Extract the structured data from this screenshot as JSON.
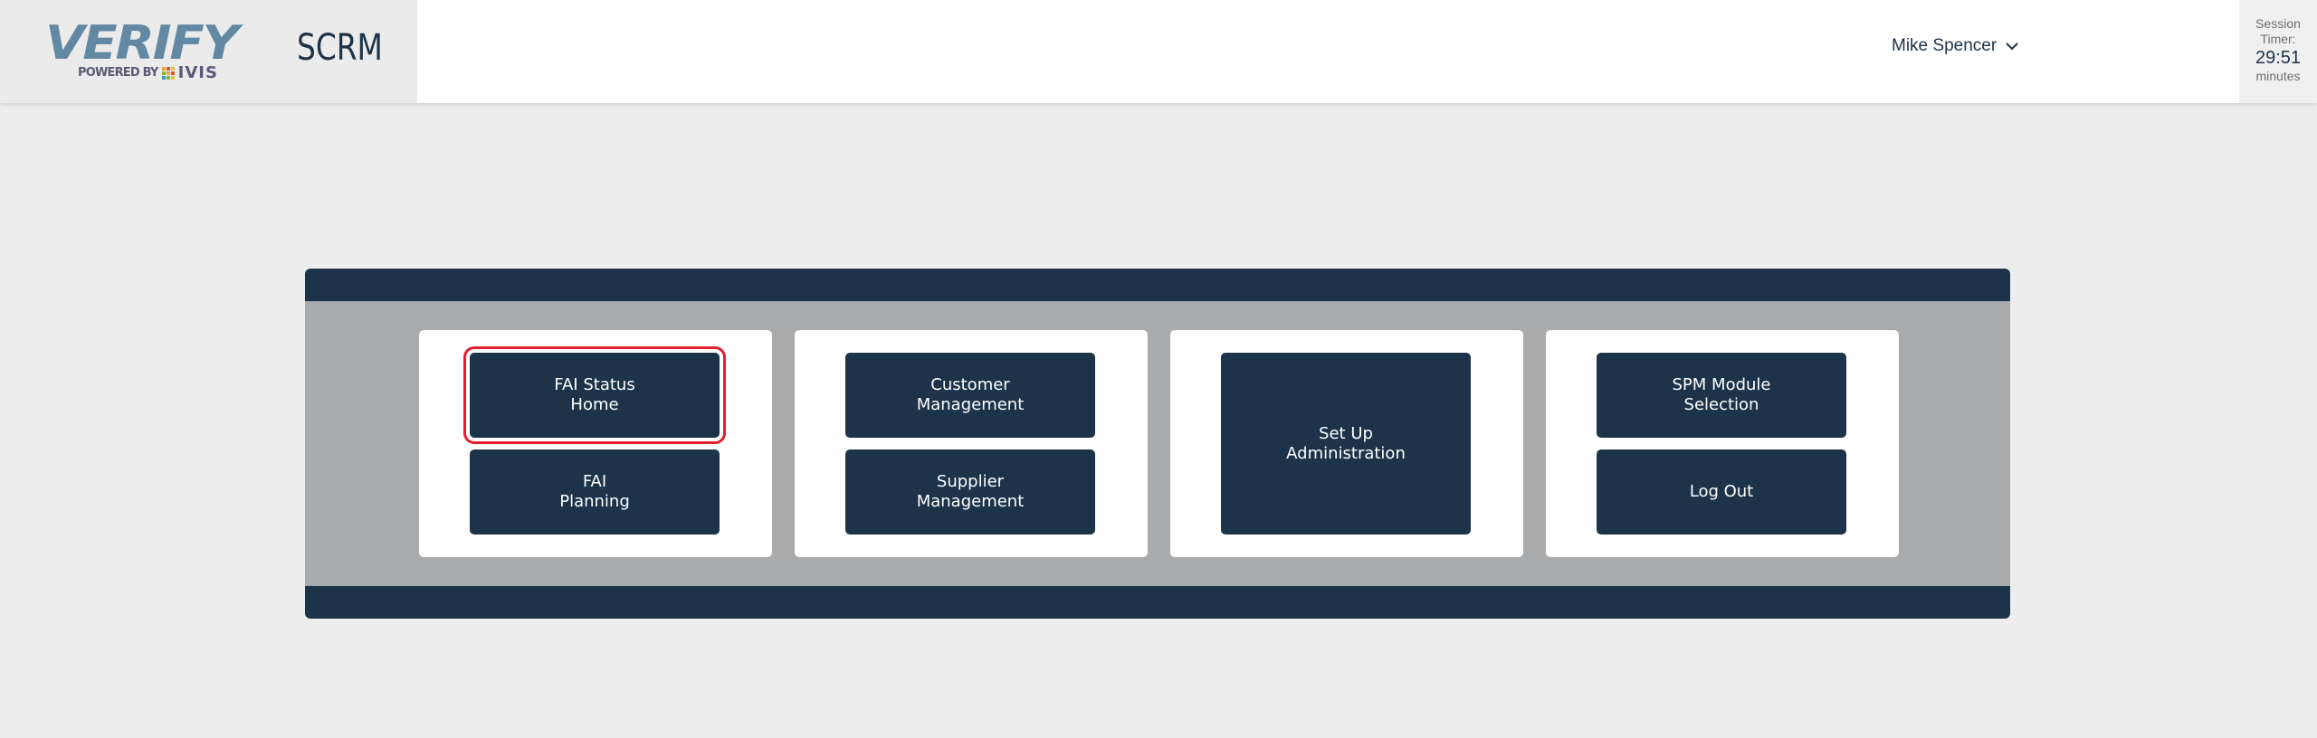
{
  "header": {
    "logo": {
      "word": "VERIFY",
      "powered_by": "POWERED BY",
      "partner": "IVIS",
      "partner_icon": "ivis-grid-icon"
    },
    "app_name": "SCRM",
    "user": {
      "name": "Mike Spencer",
      "menu_icon": "chevron-down-icon"
    },
    "session_timer": {
      "label_line1": "Session",
      "label_line2": "Timer:",
      "value": "29:51",
      "unit": "minutes"
    }
  },
  "colors": {
    "primary": "#1c3349",
    "panel": "#a9aaab",
    "highlight": "#e21f2c",
    "logo": "#6388a3"
  },
  "menu": {
    "groups": [
      {
        "buttons": [
          {
            "label": "FAI Status\nHome",
            "selected": true
          },
          {
            "label": "FAI\nPlanning"
          }
        ]
      },
      {
        "buttons": [
          {
            "label": "Customer\nManagement"
          },
          {
            "label": "Supplier\nManagement"
          }
        ]
      },
      {
        "buttons": [
          {
            "label": "Set Up\nAdministration"
          }
        ]
      },
      {
        "buttons": [
          {
            "label": "SPM Module\nSelection"
          },
          {
            "label": "Log Out"
          }
        ]
      }
    ]
  }
}
